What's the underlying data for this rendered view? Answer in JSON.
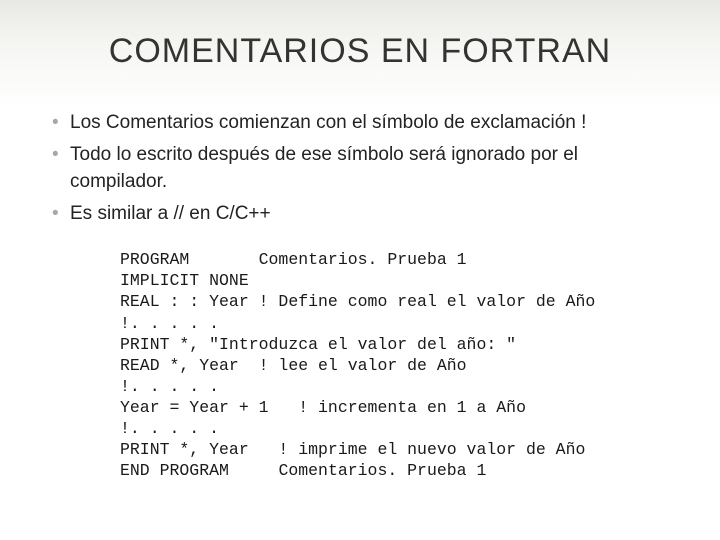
{
  "title": "COMENTARIOS EN FORTRAN",
  "bullets": {
    "b1": "Los Comentarios comienzan con el símbolo de exclamación !",
    "b2": "Todo lo escrito después de ese símbolo será ignorado por el compilador.",
    "b3": "Es similar a // en C/C++"
  },
  "code": {
    "l01a": "PROGRAM       ",
    "l01b": "Comentarios. Prueba 1",
    "l02": "IMPLICIT NONE",
    "l03": "REAL : : Year ! Define como real el valor de Año",
    "l04": "!. . . . .",
    "l05": "PRINT *, \"Introduzca el valor del año: \"",
    "l06": "READ *, Year  ! lee el valor de Año",
    "l07": "!. . . . .",
    "l08": "Year = Year + 1   ! incrementa en 1 a Año",
    "l09": "!. . . . .",
    "l10": "PRINT *, Year   ! imprime el nuevo valor de Año",
    "l11a": "END PROGRAM     ",
    "l11b": "Comentarios. Prueba 1"
  }
}
